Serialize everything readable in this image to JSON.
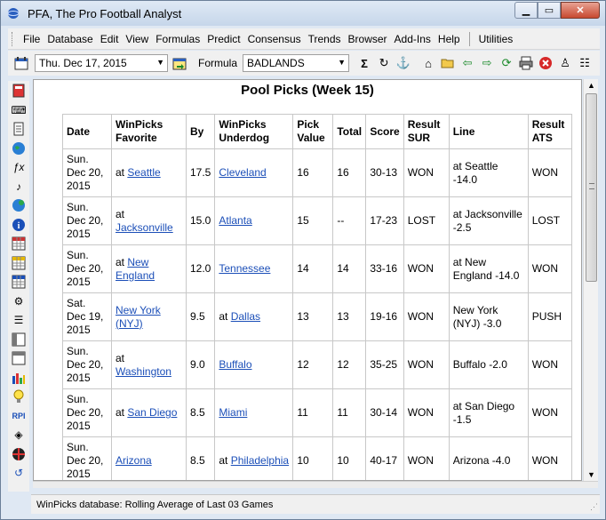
{
  "window": {
    "title": "PFA,  The Pro Football Analyst"
  },
  "menu": [
    "File",
    "Database",
    "Edit",
    "View",
    "Formulas",
    "Predict",
    "Consensus",
    "Trends",
    "Browser",
    "Add-Ins",
    "Help"
  ],
  "menu_extra": "Utilities",
  "toolbar": {
    "date_value": "Thu. Dec 17, 2015",
    "formula_label": "Formula",
    "formula_value": "BADLANDS"
  },
  "page": {
    "title": "Pool Picks (Week 15)",
    "headers": [
      "Date",
      "WinPicks Favorite",
      "By",
      "WinPicks Underdog",
      "Pick Value",
      "Total",
      "Score",
      "Result SUR",
      "Line",
      "Result ATS"
    ],
    "rows": [
      {
        "date": "Sun. Dec 20, 2015",
        "fav_prefix": "at ",
        "fav": "Seattle",
        "by": "17.5",
        "dog_prefix": "",
        "dog": "Cleveland",
        "pick_value": "16",
        "total": "16",
        "score": "30-13",
        "sur": "WON",
        "line": "at Seattle -14.0",
        "ats": "WON"
      },
      {
        "date": "Sun. Dec 20, 2015",
        "fav_prefix": "at ",
        "fav": "Jacksonville",
        "by": "15.0",
        "dog_prefix": "",
        "dog": "Atlanta",
        "pick_value": "15",
        "total": "--",
        "score": "17-23",
        "sur": "LOST",
        "line": "at Jacksonville -2.5",
        "ats": "LOST"
      },
      {
        "date": "Sun. Dec 20, 2015",
        "fav_prefix": "at ",
        "fav": "New England",
        "by": "12.0",
        "dog_prefix": "",
        "dog": "Tennessee",
        "pick_value": "14",
        "total": "14",
        "score": "33-16",
        "sur": "WON",
        "line": "at New England -14.0",
        "ats": "WON"
      },
      {
        "date": "Sat. Dec 19, 2015",
        "fav_prefix": "",
        "fav": "New York (NYJ)",
        "by": "9.5",
        "dog_prefix": "at ",
        "dog": "Dallas",
        "pick_value": "13",
        "total": "13",
        "score": "19-16",
        "sur": "WON",
        "line": "New York (NYJ) -3.0",
        "ats": "PUSH"
      },
      {
        "date": "Sun. Dec 20, 2015",
        "fav_prefix": "at ",
        "fav": "Washington",
        "by": "9.0",
        "dog_prefix": "",
        "dog": "Buffalo",
        "pick_value": "12",
        "total": "12",
        "score": "35-25",
        "sur": "WON",
        "line": "Buffalo -2.0",
        "ats": "WON"
      },
      {
        "date": "Sun. Dec 20, 2015",
        "fav_prefix": "at ",
        "fav": "San Diego",
        "by": "8.5",
        "dog_prefix": "",
        "dog": "Miami",
        "pick_value": "11",
        "total": "11",
        "score": "30-14",
        "sur": "WON",
        "line": "at San Diego -1.5",
        "ats": "WON"
      },
      {
        "date": "Sun. Dec 20, 2015",
        "fav_prefix": "",
        "fav": "Arizona",
        "by": "8.5",
        "dog_prefix": "at ",
        "dog": "Philadelphia",
        "pick_value": "10",
        "total": "10",
        "score": "40-17",
        "sur": "WON",
        "line": "Arizona -4.0",
        "ats": "WON"
      }
    ]
  },
  "status": {
    "text": "WinPicks database:  Rolling Average of Last 03 Games"
  },
  "icons": {
    "toolbar": [
      "calendar-icon",
      "calendar-go-icon",
      "sigma-icon",
      "refresh-icon",
      "anchor-icon",
      "home-icon",
      "folder-open-icon",
      "back-arrow-icon",
      "forward-arrow-icon",
      "reload-icon",
      "print-icon",
      "stop-icon",
      "wizard-icon",
      "settings-icon"
    ],
    "sidebar": [
      "calculator-icon",
      "keyboard-icon",
      "notepad-icon",
      "globe-icon",
      "function-icon",
      "music-icon",
      "network-icon",
      "info-icon",
      "spreadsheet-icon",
      "spreadsheet-edit-icon",
      "spreadsheet-chart-icon",
      "settings-sliders-icon",
      "list-icon",
      "layout-icon",
      "window-icon",
      "bar-chart-icon",
      "lightbulb-icon",
      "rpi-icon",
      "cube-icon",
      "colorwheel-icon",
      "cycle-icon"
    ]
  }
}
